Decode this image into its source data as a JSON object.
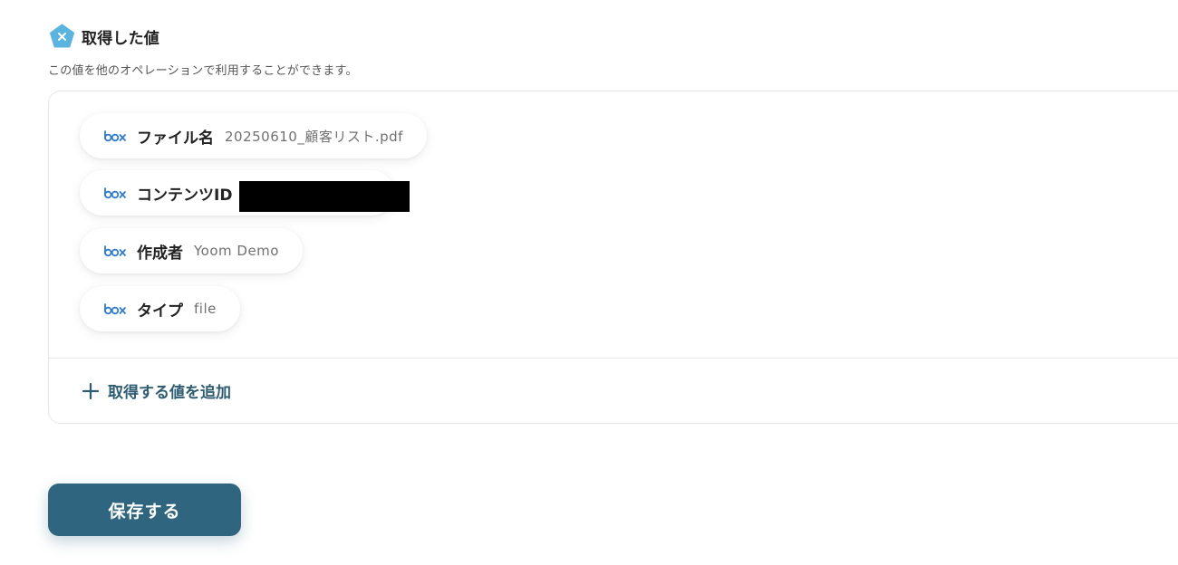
{
  "section": {
    "title": "取得した値",
    "description": "この値を他のオペレーションで利用することができます。",
    "icon": "pentagon-x-icon",
    "icon_color": "#5ab4e0"
  },
  "values": [
    {
      "service_icon": "box-logo-icon",
      "label": "ファイル名",
      "value": "20250610_顧客リスト.pdf"
    },
    {
      "service_icon": "box-logo-icon",
      "label": "コンテンツID",
      "value": "",
      "redacted": true
    },
    {
      "service_icon": "box-logo-icon",
      "label": "作成者",
      "value": "Yoom Demo"
    },
    {
      "service_icon": "box-logo-icon",
      "label": "タイプ",
      "value": "file"
    }
  ],
  "add_button": {
    "label": "取得する値を追加",
    "icon": "plus-icon"
  },
  "save_button": {
    "label": "保存する"
  },
  "colors": {
    "primary": "#2f657f",
    "link": "#2e5c72",
    "box_brand": "#2b7bd6",
    "redaction": "#000000"
  }
}
